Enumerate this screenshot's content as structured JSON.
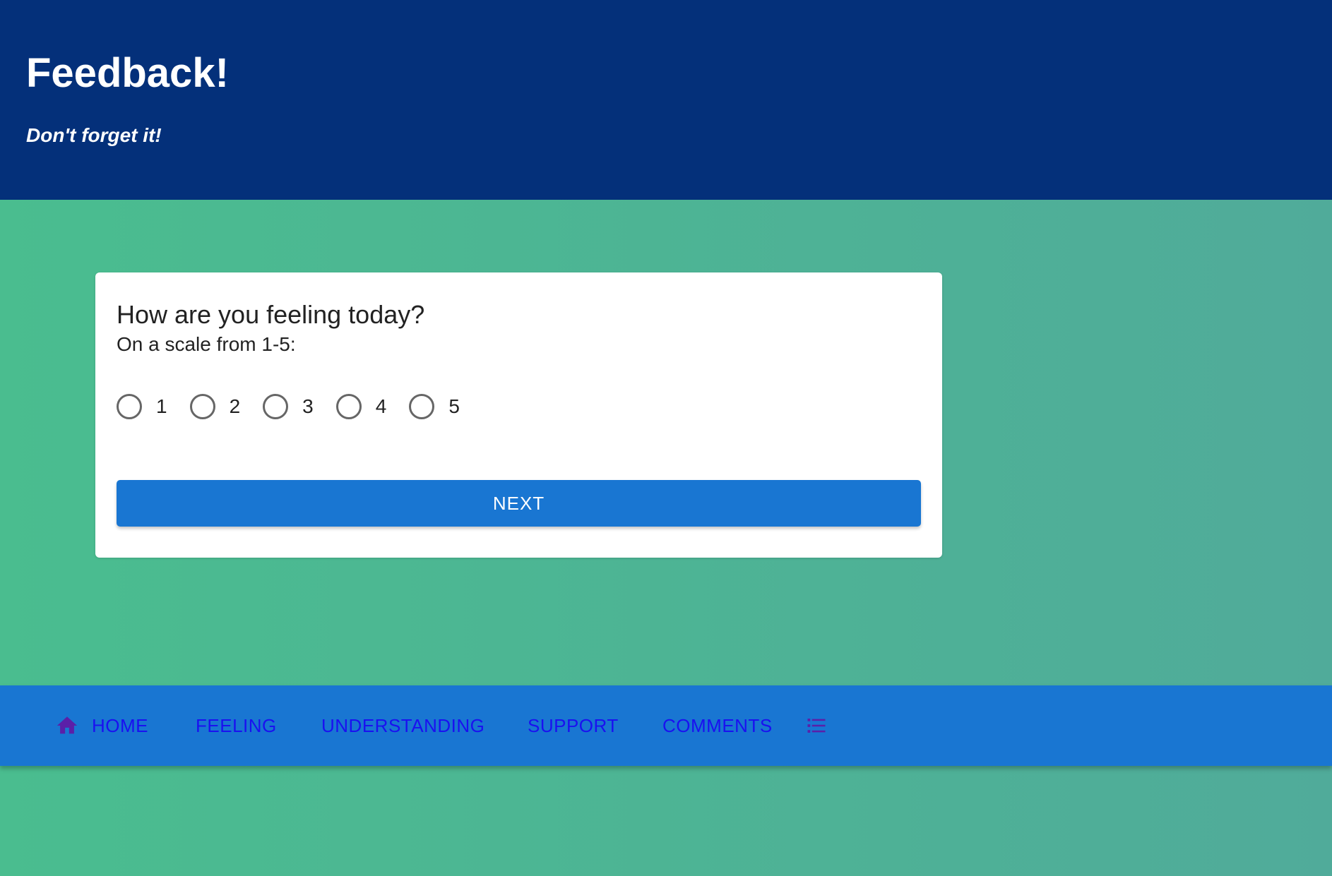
{
  "header": {
    "title": "Feedback!",
    "subtitle": "Don't forget it!"
  },
  "card": {
    "question": "How are you feeling today?",
    "scale_label": "On a scale from 1-5:",
    "options": [
      "1",
      "2",
      "3",
      "4",
      "5"
    ],
    "next_label": "NEXT"
  },
  "nav": {
    "items": [
      {
        "label": "HOME",
        "icon": "home-icon"
      },
      {
        "label": "FEELING"
      },
      {
        "label": "UNDERSTANDING"
      },
      {
        "label": "SUPPORT"
      },
      {
        "label": "COMMENTS"
      },
      {
        "label": "",
        "icon": "list-icon"
      }
    ]
  },
  "colors": {
    "header_bg": "#04307a",
    "accent": "#1976d2",
    "nav_text": "#1a10f0",
    "icon_purple": "#5b1fa8",
    "gradient_start": "#4abd8f",
    "gradient_end": "#50ab9a"
  }
}
